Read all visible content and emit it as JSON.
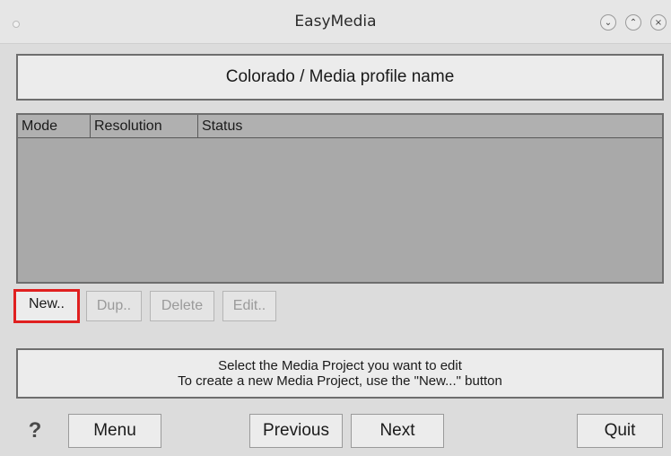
{
  "window": {
    "title": "EasyMedia",
    "controls": {
      "minimize": "⌄",
      "maximize": "⌃",
      "close": "×"
    }
  },
  "header": {
    "title": "Colorado / Media profile name"
  },
  "table": {
    "columns": [
      "Mode",
      "Resolution",
      "Status"
    ],
    "rows": []
  },
  "row_buttons": {
    "new": "New..",
    "dup": "Dup..",
    "delete": "Delete",
    "edit": "Edit.."
  },
  "info": {
    "line1": "Select the Media Project you want to edit",
    "line2": "To create a new Media Project, use the \"New...\" button"
  },
  "footer": {
    "help": "?",
    "menu": "Menu",
    "previous": "Previous",
    "next": "Next",
    "quit": "Quit"
  },
  "colors": {
    "highlight": "#e02020",
    "table_bg": "#a9a9a9"
  }
}
